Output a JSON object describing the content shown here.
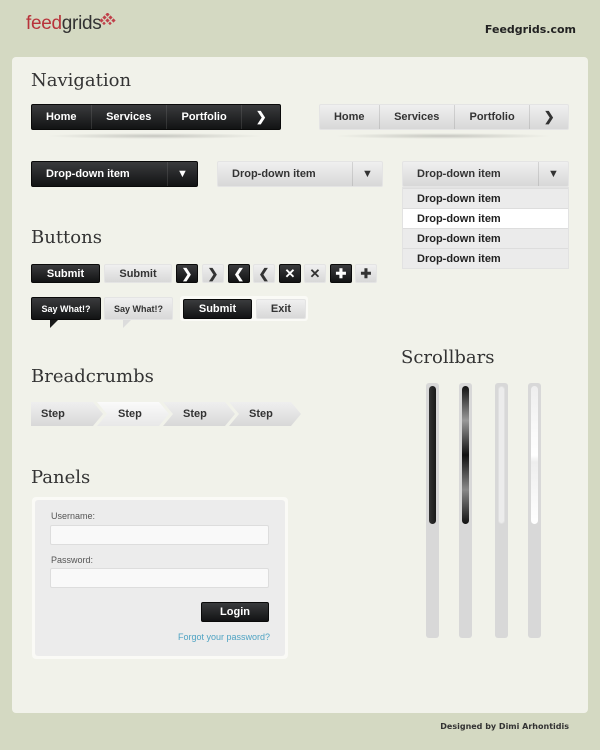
{
  "header": {
    "logo_part1": "feed",
    "logo_part2": "grids",
    "site_link": "Feedgrids.com",
    "brand_color": "#b8333a"
  },
  "navigation": {
    "title": "Navigation",
    "items": [
      "Home",
      "Services",
      "Portfolio"
    ],
    "next_icon": "chevron-right-icon"
  },
  "dropdowns": {
    "label": "Drop-down item",
    "open_items": [
      "Drop-down item",
      "Drop-down item",
      "Drop-down item",
      "Drop-down item"
    ],
    "highlighted_index": 1
  },
  "buttons": {
    "title": "Buttons",
    "submit": "Submit",
    "say_what": "Say What!?",
    "exit": "Exit",
    "icons": [
      "chevron-right-icon",
      "chevron-left-icon",
      "close-icon",
      "plus-icon"
    ]
  },
  "breadcrumbs": {
    "title": "Breadcrumbs",
    "steps": [
      "Step",
      "Step",
      "Step",
      "Step"
    ],
    "active_index": 1
  },
  "panels": {
    "title": "Panels",
    "username_label": "Username:",
    "password_label": "Password:",
    "username_value": "",
    "password_value": "",
    "login": "Login",
    "forgot": "Forgot your password?",
    "link_color": "#4fa3c3"
  },
  "scrollbars": {
    "title": "Scrollbars",
    "styles": [
      "dark",
      "dark-glossy",
      "light",
      "light-glossy"
    ]
  },
  "footer": {
    "credit": "Designed by Dimi Arhontidis"
  }
}
